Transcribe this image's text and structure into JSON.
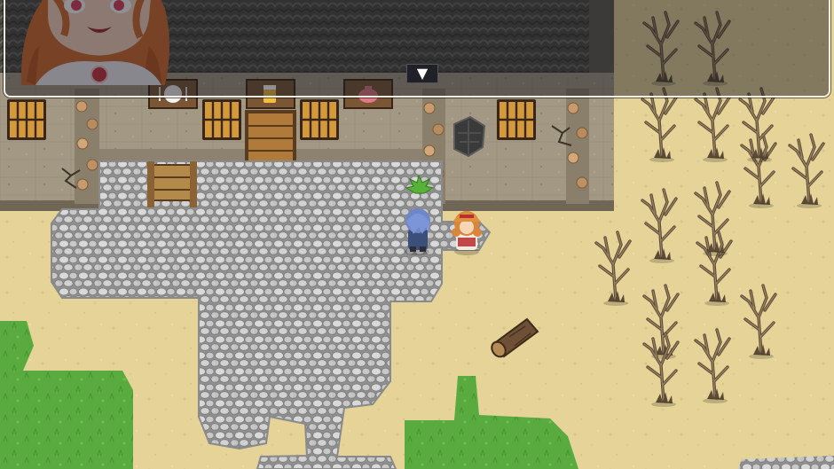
{
  "dialog": {
    "text": "",
    "speaker_portrait": "red-haired-girl-face",
    "continue_icon": "▼"
  },
  "colors": {
    "sand": "#e6d49a",
    "grass": "#5fb043",
    "cobblestone": "#b9b9b9",
    "wall": "#a59a87",
    "roof": "#55554d",
    "dialog_border": "#f4f1e8"
  }
}
